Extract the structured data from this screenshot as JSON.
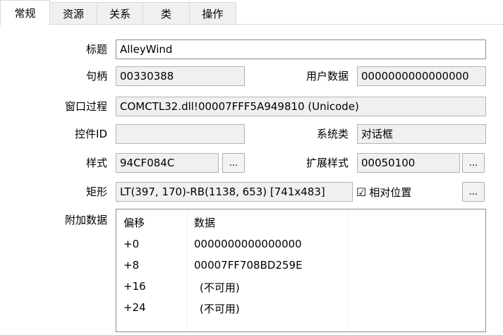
{
  "tabs": [
    {
      "label": "常规"
    },
    {
      "label": "资源"
    },
    {
      "label": "关系"
    },
    {
      "label": "类"
    },
    {
      "label": "操作"
    }
  ],
  "form": {
    "title_label": "标题",
    "title_value": "AlleyWind",
    "handle_label": "句柄",
    "handle_value": "00330388",
    "userdata_label": "用户数据",
    "userdata_value": "0000000000000000",
    "wndproc_label": "窗口过程",
    "wndproc_value": "COMCTL32.dll!00007FFF5A949810 (Unicode)",
    "ctrlid_label": "控件ID",
    "ctrlid_value": "",
    "sysclass_label": "系统类",
    "sysclass_value": "对话框",
    "style_label": "样式",
    "style_value": "94CF084C",
    "exstyle_label": "扩展样式",
    "exstyle_value": "00050100",
    "rect_label": "矩形",
    "rect_value": "LT(397, 170)-RB(1138, 653) [741x483]",
    "relative_label": "相对位置",
    "relative_checked": true,
    "checkmark": "☑",
    "more_label": "...",
    "extra_label": "附加数据"
  },
  "extra_table": {
    "headers": [
      "偏移",
      "数据"
    ],
    "rows": [
      [
        "+0",
        "0000000000000000"
      ],
      [
        "+8",
        "00007FF708BD259E"
      ],
      [
        "+16",
        "(不可用)"
      ],
      [
        "+24",
        "(不可用)"
      ]
    ]
  }
}
